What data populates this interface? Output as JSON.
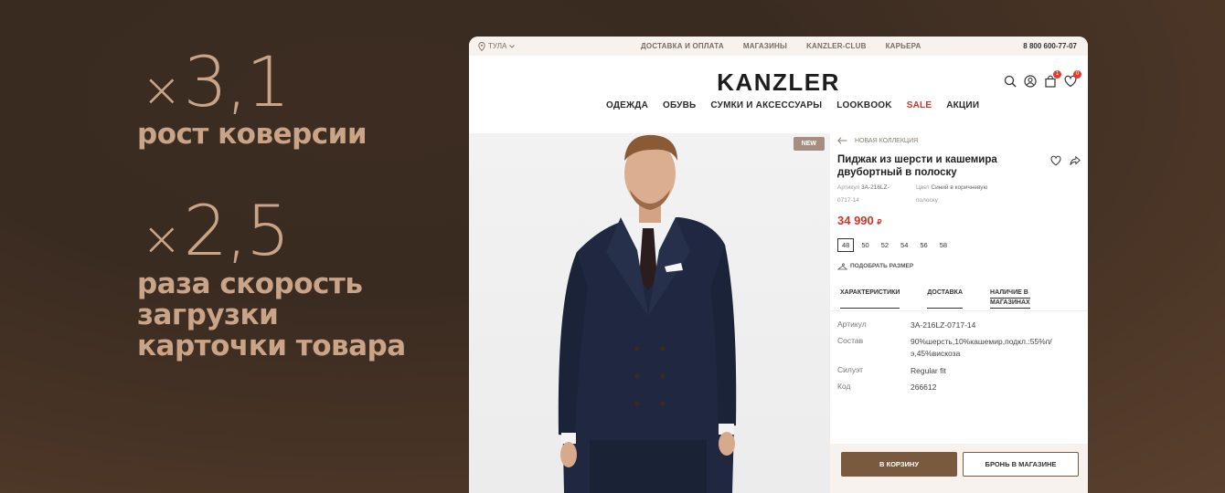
{
  "promo": {
    "stat1_num": "3,1",
    "stat1_caption": "рост коверсии",
    "stat2_num": "2,5",
    "stat2_caption_l1": "раза скорость",
    "stat2_caption_l2": "загрузки",
    "stat2_caption_l3": "карточки товара",
    "multiply": "×"
  },
  "topbar": {
    "city": "ТУЛА",
    "nav": [
      "ДОСТАВКА И ОПЛАТА",
      "МАГАЗИНЫ",
      "KANZLER-CLUB",
      "КАРЬЕРА"
    ],
    "phone": "8 800 600-77-07"
  },
  "header": {
    "logo": "KANZLER",
    "cart_count": "1",
    "fav_count": "0"
  },
  "main_nav": [
    "ОДЕЖДА",
    "ОБУВЬ",
    "СУМКИ И АКСЕССУАРЫ",
    "LOOKBOOK",
    "SALE",
    "АКЦИИ"
  ],
  "product": {
    "new_tag": "NEW",
    "breadcrumb": "НОВАЯ КОЛЛЕКЦИЯ",
    "title": "Пиджак из шерсти и кашемира двубортный в полоску",
    "article_label": "Артикул",
    "article_value": "3A-216LZ-",
    "article_value2": "0717-14",
    "color_label": "Цвет",
    "color_value": "Синий в коричневую",
    "color_value2": "полоску",
    "price": "34 990",
    "currency": "₽",
    "sizes": [
      "48",
      "50",
      "52",
      "54",
      "56",
      "58"
    ],
    "selected_size": "48",
    "fit_size": "ПОДОБРАТЬ РАЗМЕР",
    "tabs": [
      "ХАРАКТЕРИСТИКИ",
      "ДОСТАВКА",
      "НАЛИЧИЕ В",
      "МАГАЗИНАХ"
    ],
    "specs": {
      "article_k": "Артикул",
      "article_v": "3A-216LZ-0717-14",
      "comp_k": "Состав",
      "comp_v1": "90%шерсть,10%кашемир,подкл.:55%п/",
      "comp_v2": "э,45%вискоза",
      "sil_k": "Силуэт",
      "sil_v": "Regular fit",
      "code_k": "Код",
      "code_v": "266612"
    },
    "btn_cart": "В КОРЗИНУ",
    "btn_store": "БРОНЬ В МАГАЗИНЕ"
  },
  "colors": {
    "accent_brown": "#7a5a3e",
    "promo_text": "#c9a487",
    "sale_red": "#d2342a"
  }
}
